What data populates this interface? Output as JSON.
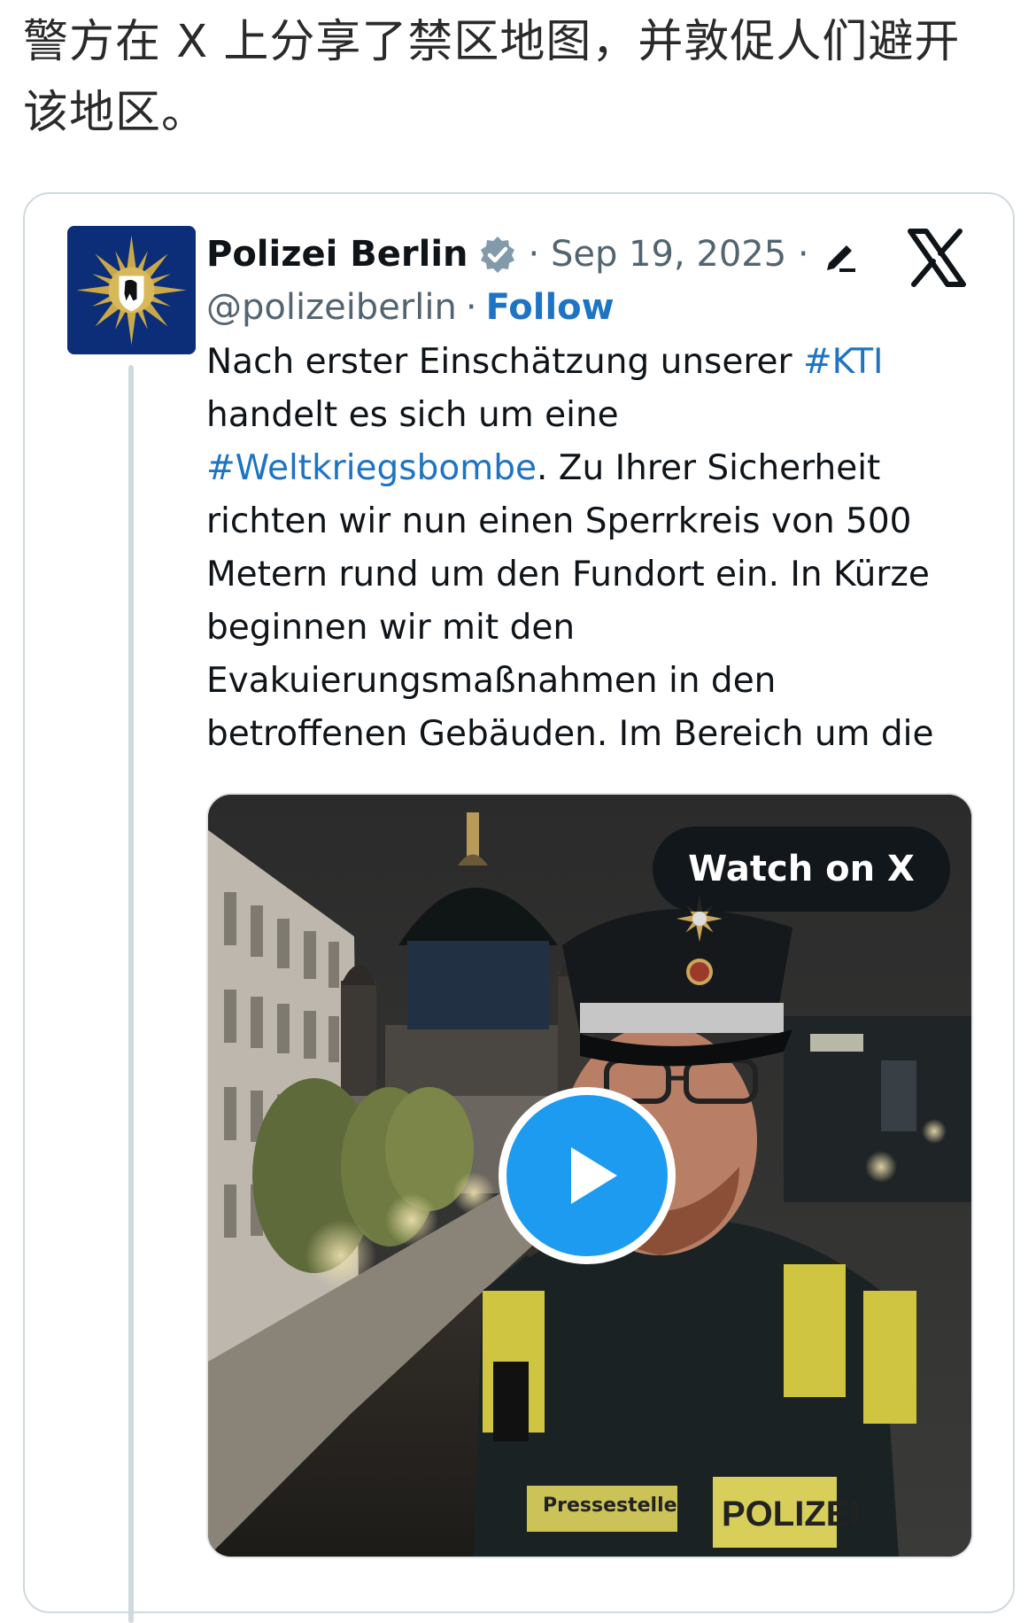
{
  "intro_text": "警方在 X 上分享了禁区地图，并敦促人们避开该地区。",
  "tweet": {
    "display_name": "Polizei Berlin",
    "date": "· Sep 19, 2025 ·",
    "handle": "@polizeiberlin",
    "separator": "·",
    "follow_label": "Follow",
    "text_lines": {
      "l1a": "Nach erster Einschätzung unserer ",
      "l1b": "#KTI",
      "l2": "handelt es sich um eine",
      "l3a": "#Weltkriegsbombe",
      "l3b": ". Zu Ihrer Sicherheit",
      "l4": "richten wir nun einen Sperrkreis von 500",
      "l5": "Metern rund um den Fundort ein. In Kürze",
      "l6": "beginnen wir mit den",
      "l7": "Evakuierungsmaßnahmen in den",
      "l8": "betroffenen Gebäuden. Im Bereich um die"
    },
    "media": {
      "watch_label": "Watch on X",
      "vest_label": "Pressestelle",
      "badge_label": "POLIZEI"
    }
  },
  "colors": {
    "link": "#1d74c4",
    "play_button": "#1d9bf0",
    "avatar_bg": "#0c2e78",
    "vest_yellow": "#e2d63a"
  },
  "icons": [
    "verified-badge-icon",
    "edit-icon",
    "x-logo-icon",
    "play-icon"
  ]
}
